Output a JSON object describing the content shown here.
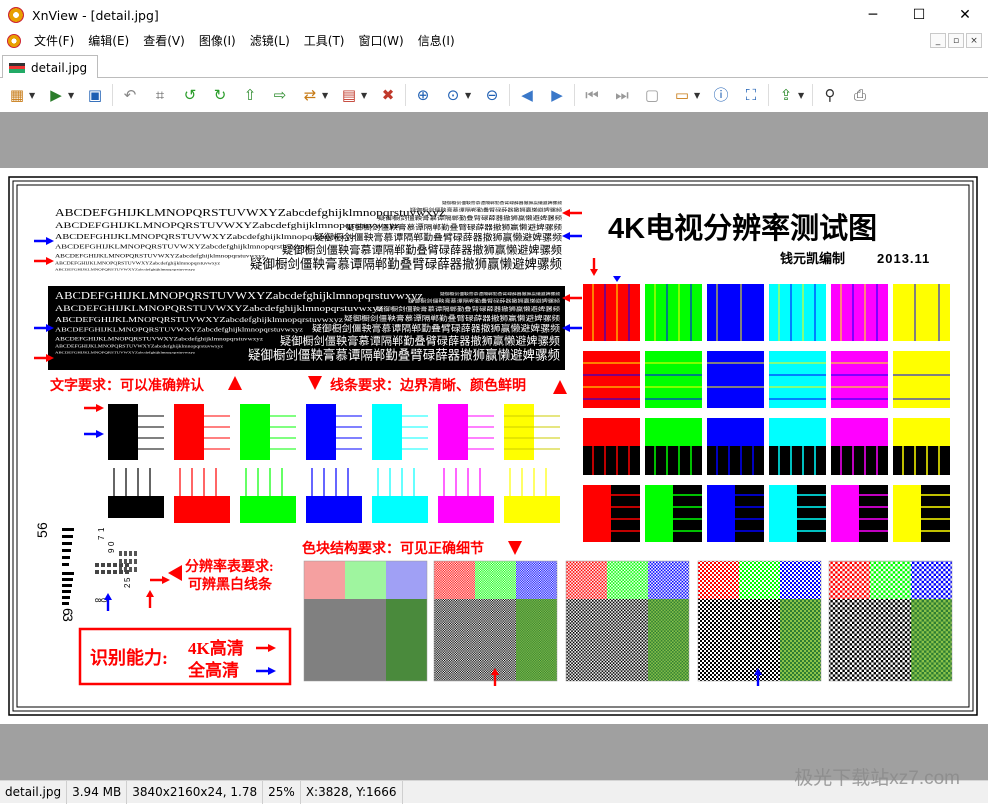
{
  "window": {
    "title": "XnView - [detail.jpg]",
    "min_glyph": "─",
    "max_glyph": "☐",
    "close_glyph": "✕"
  },
  "menu": {
    "items": [
      {
        "id": "file",
        "label": "文件(F)"
      },
      {
        "id": "edit",
        "label": "编辑(E)"
      },
      {
        "id": "view",
        "label": "查看(V)"
      },
      {
        "id": "image",
        "label": "图像(I)"
      },
      {
        "id": "filter",
        "label": "滤镜(L)"
      },
      {
        "id": "tools",
        "label": "工具(T)"
      },
      {
        "id": "window",
        "label": "窗口(W)"
      },
      {
        "id": "info",
        "label": "信息(I)"
      }
    ],
    "mdi_controls": [
      "_",
      "▫",
      "×"
    ]
  },
  "tabs": [
    {
      "label": "detail.jpg"
    }
  ],
  "toolbar": {
    "buttons": [
      {
        "icon": "browser-icon",
        "glyph": "▦",
        "color": "#c77b16",
        "menu": true
      },
      {
        "icon": "open-icon",
        "glyph": "▶",
        "color": "#2b7d2b",
        "menu": true
      },
      {
        "icon": "save-icon",
        "glyph": "▣",
        "color": "#1e5fb3",
        "menu": false
      },
      {
        "icon": "undo-icon",
        "glyph": "↶",
        "color": "#888888",
        "menu": false
      },
      {
        "icon": "crop-icon",
        "glyph": "⌗",
        "color": "#555555",
        "menu": false
      },
      {
        "icon": "rotate-left-icon",
        "glyph": "↺",
        "color": "#2a9d2a",
        "menu": false
      },
      {
        "icon": "rotate-right-icon",
        "glyph": "↻",
        "color": "#2a9d2a",
        "menu": false
      },
      {
        "icon": "export-icon",
        "glyph": "⇧",
        "color": "#2a8a2a",
        "menu": false
      },
      {
        "icon": "import-icon",
        "glyph": "⇨",
        "color": "#2a8a2a",
        "menu": false
      },
      {
        "icon": "convert-icon",
        "glyph": "⇄",
        "color": "#c77b16",
        "menu": true
      },
      {
        "icon": "adjust-icon",
        "glyph": "▤",
        "color": "#c0392b",
        "menu": true
      },
      {
        "icon": "delete-icon",
        "glyph": "✖",
        "color": "#c0392b",
        "menu": false
      },
      {
        "icon": "zoom-in-icon",
        "glyph": "⊕",
        "color": "#1e5fb3",
        "menu": false
      },
      {
        "icon": "zoom-actual-icon",
        "glyph": "⊙",
        "color": "#1e5fb3",
        "menu": true
      },
      {
        "icon": "zoom-out-icon",
        "glyph": "⊖",
        "color": "#1e5fb3",
        "menu": false
      },
      {
        "icon": "prev-icon",
        "glyph": "◀",
        "color": "#3a78c9",
        "menu": false
      },
      {
        "icon": "next-icon",
        "glyph": "▶",
        "color": "#3a78c9",
        "menu": false
      },
      {
        "icon": "first-icon",
        "glyph": "⏮",
        "color": "#999999",
        "menu": false
      },
      {
        "icon": "last-icon",
        "glyph": "⏭",
        "color": "#999999",
        "menu": false
      },
      {
        "icon": "page-icon",
        "glyph": "▢",
        "color": "#999999",
        "menu": false
      },
      {
        "icon": "slideshow-icon",
        "glyph": "▭",
        "color": "#c77b16",
        "menu": true
      },
      {
        "icon": "properties-icon",
        "glyph": "ⓘ",
        "color": "#1e5fb3",
        "menu": false
      },
      {
        "icon": "fullscreen-icon",
        "glyph": "⛶",
        "color": "#1e5fb3",
        "menu": false
      },
      {
        "icon": "share-icon",
        "glyph": "⇪",
        "color": "#2a8a2a",
        "menu": true
      },
      {
        "icon": "binoculars-icon",
        "glyph": "⚲",
        "color": "#333333",
        "menu": false
      },
      {
        "icon": "print-icon",
        "glyph": "⎙",
        "color": "#555555",
        "menu": false
      }
    ]
  },
  "image": {
    "title": "4K电视分辨率测试图",
    "author": "钱元凯编制",
    "year": "2013.11",
    "alphabet": "ABCDEFGHIJKLMNOPQRSTUVWXYZabcdefghijklmnopqrstuvwxyz",
    "chinese_sample": "疑御橱剑僵鞅膏慕谭隔郸勤叠臂碌薛器撤狮赢懒避婢骡频",
    "text_requirement": "文字要求：可以准确辨认",
    "line_requirement": "线条要求：边界清晰、颜色鲜明",
    "block_requirement": "色块结构要求：可见正确细节",
    "resolution_requirement_1": "分辨率表要求:",
    "resolution_requirement_2": "可辨黑白线条",
    "ability_label": "识别能力:",
    "ability_4k": "4K高清",
    "ability_fhd": "全高清",
    "chart_digits": [
      "5",
      "6",
      "7",
      "1",
      "9",
      "0",
      "6",
      "3",
      "8",
      "0",
      "2",
      "5"
    ],
    "colors": [
      "#ff0000",
      "#00ff00",
      "#0000ff",
      "#00ffff",
      "#ff00ff",
      "#ffff00"
    ],
    "small_colors": [
      "#000000",
      "#ff0000",
      "#00ff00",
      "#0000ff",
      "#00ffff",
      "#ff00ff",
      "#ffff00"
    ]
  },
  "status": {
    "filename": "detail.jpg",
    "size": "3.94 MB",
    "dimensions": "3840x2160x24, 1.78",
    "zoom": "25%",
    "coords": "X:3828, Y:1666"
  },
  "watermark": "极光下载站xz7.com"
}
